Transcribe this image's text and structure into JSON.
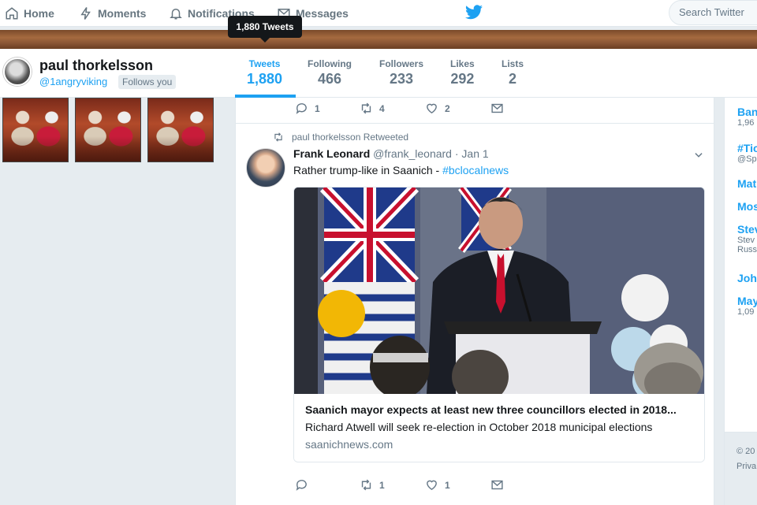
{
  "nav": {
    "home": "Home",
    "moments": "Moments",
    "notifications": "Notifications",
    "messages": "Messages",
    "search_placeholder": "Search Twitter"
  },
  "tooltip": "1,880 Tweets",
  "profile": {
    "name": "paul thorkelsson",
    "handle": "@1angryviking",
    "follows_you": "Follows you",
    "stats": [
      {
        "label": "Tweets",
        "value": "1,880",
        "active": true
      },
      {
        "label": "Following",
        "value": "466"
      },
      {
        "label": "Followers",
        "value": "233"
      },
      {
        "label": "Likes",
        "value": "292"
      },
      {
        "label": "Lists",
        "value": "2"
      }
    ]
  },
  "prev_tweet_actions": {
    "replies": "1",
    "retweets": "4",
    "likes": "2"
  },
  "tweet": {
    "retweeted_by": "paul thorkelsson Retweeted",
    "author_name": "Frank Leonard",
    "author_handle": "@frank_leonard",
    "date": "· Jan 1",
    "text": "Rather trump-like in Saanich  - ",
    "hashtag": "#bclocalnews",
    "card": {
      "title": "Saanich mayor expects at least new three councillors elected in 2018...",
      "description": "Richard Atwell will seek re-election in October 2018 municipal elections",
      "url": "saanichnews.com"
    },
    "actions": {
      "replies": "",
      "retweets": "1",
      "likes": "1"
    }
  },
  "sidebar": {
    "items": [
      {
        "name": "Ban",
        "sub": "1,96"
      },
      {
        "name": "#Tic",
        "sub": "@Sp"
      },
      {
        "name": "Mat",
        "sub": ""
      },
      {
        "name": "Mos",
        "sub": ""
      },
      {
        "name": "Stev",
        "sub": "Stev"
      },
      {
        "name": "",
        "sub": "Russ"
      },
      {
        "name": "Joh",
        "sub": ""
      },
      {
        "name": "May",
        "sub": "1,09"
      }
    ],
    "footer": [
      "© 20",
      "Priva"
    ]
  },
  "colors": {
    "accent": "#1da1f2",
    "muted": "#657786",
    "bg": "#e6ecf0"
  }
}
